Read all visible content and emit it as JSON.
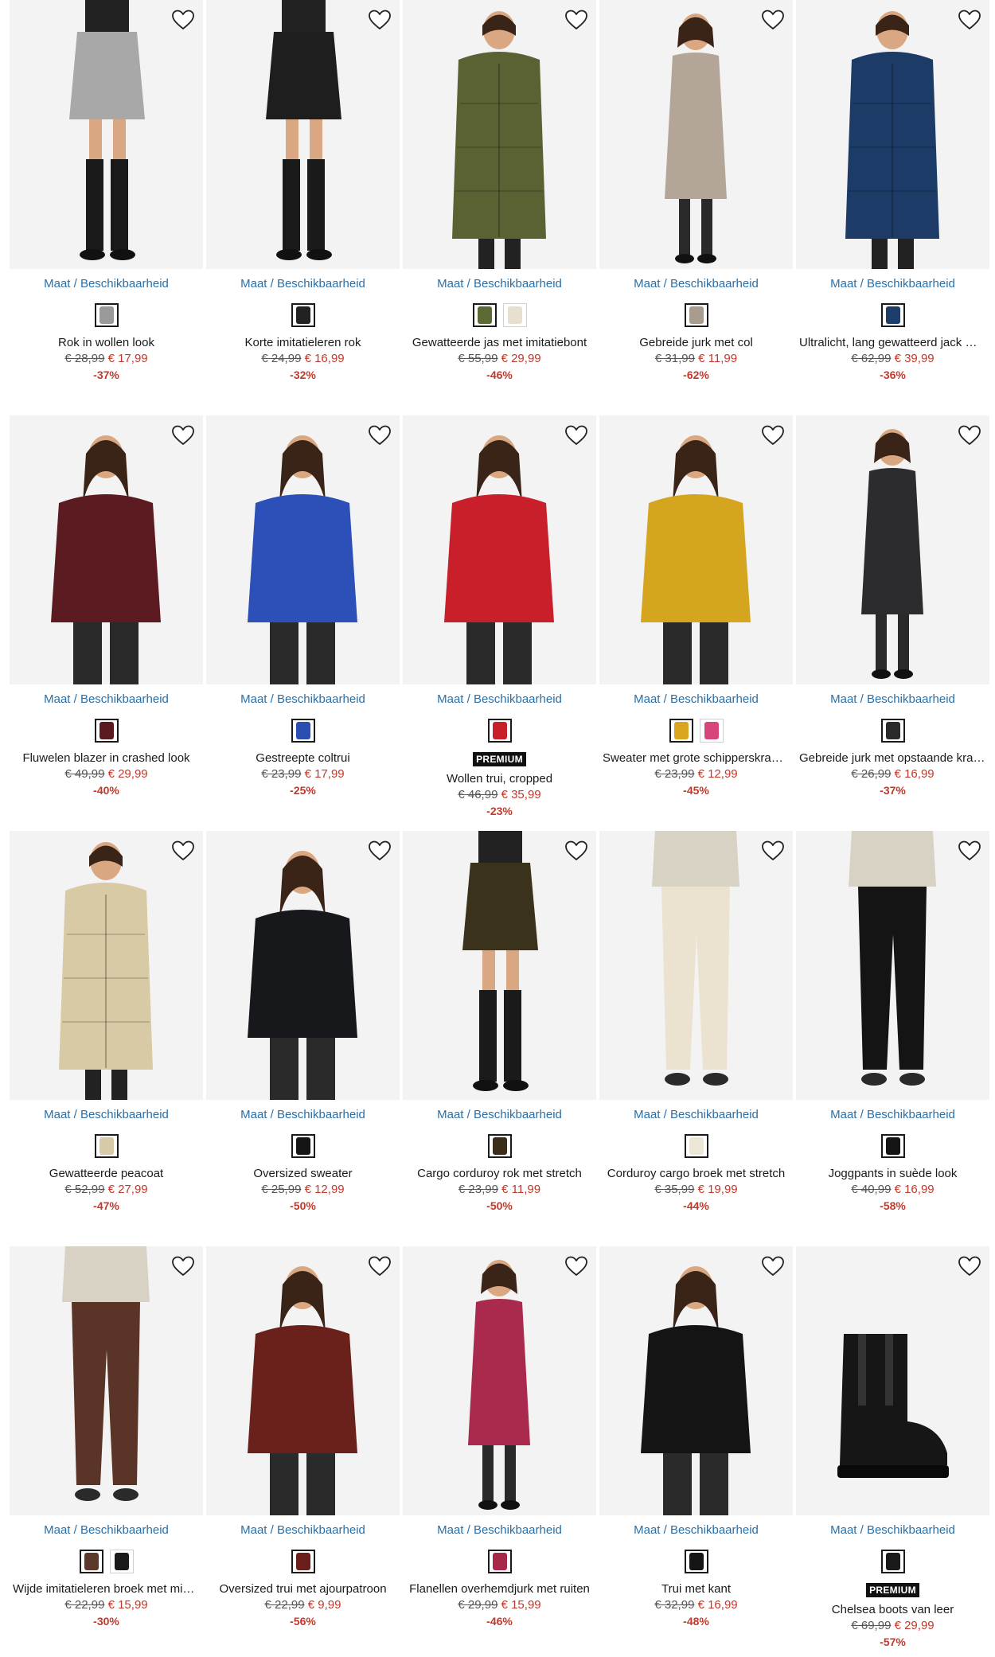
{
  "common": {
    "availability_label": "Maat / Beschikbaarheid",
    "premium_label": "PREMIUM",
    "heart_icon": "heart-icon"
  },
  "products": [
    {
      "title": "Rok in wollen look",
      "old_price": "€ 28,99",
      "new_price": "€ 17,99",
      "discount": "-37%",
      "premium": false,
      "swatches": [
        "#9a9a9a"
      ],
      "garment": "#a8a8a8",
      "image": "skirt"
    },
    {
      "title": "Korte imitatieleren rok",
      "old_price": "€ 24,99",
      "new_price": "€ 16,99",
      "discount": "-32%",
      "premium": false,
      "swatches": [
        "#222222"
      ],
      "garment": "#1e1e1e",
      "image": "skirt"
    },
    {
      "title": "Gewatteerde jas met imitatiebont",
      "old_price": "€ 55,99",
      "new_price": "€ 29,99",
      "discount": "-46%",
      "premium": false,
      "swatches": [
        "#5c6b35",
        "#e8e0cf"
      ],
      "garment": "#5a6234",
      "image": "coat"
    },
    {
      "title": "Gebreide jurk met col",
      "old_price": "€ 31,99",
      "new_price": "€ 11,99",
      "discount": "-62%",
      "premium": false,
      "swatches": [
        "#a89c8e"
      ],
      "garment": "#b3a597",
      "image": "dress"
    },
    {
      "title": "Ultralicht, lang gewatteerd jack met capuchon",
      "old_price": "€ 62,99",
      "new_price": "€ 39,99",
      "discount": "-36%",
      "premium": false,
      "swatches": [
        "#1d3d6b"
      ],
      "garment": "#1c3b66",
      "image": "coat"
    },
    {
      "title": "Fluwelen blazer in crashed look",
      "old_price": "€ 49,99",
      "new_price": "€ 29,99",
      "discount": "-40%",
      "premium": false,
      "swatches": [
        "#5a1a1f"
      ],
      "garment": "#5c1a21",
      "image": "top"
    },
    {
      "title": "Gestreepte coltrui",
      "old_price": "€ 23,99",
      "new_price": "€ 17,99",
      "discount": "-25%",
      "premium": false,
      "swatches": [
        "#2a4fb0"
      ],
      "garment": "#2d4fb8",
      "image": "top"
    },
    {
      "title": "Wollen trui, cropped",
      "old_price": "€ 46,99",
      "new_price": "€ 35,99",
      "discount": "-23%",
      "premium": true,
      "swatches": [
        "#c8202a"
      ],
      "garment": "#c81f2b",
      "image": "top"
    },
    {
      "title": "Sweater met grote schipperskraag, oversized",
      "old_price": "€ 23,99",
      "new_price": "€ 12,99",
      "discount": "-45%",
      "premium": false,
      "swatches": [
        "#d9a521",
        "#d8457a"
      ],
      "garment": "#d6a51f",
      "image": "top"
    },
    {
      "title": "Gebreide jurk met opstaande kraag",
      "old_price": "€ 26,99",
      "new_price": "€ 16,99",
      "discount": "-37%",
      "premium": false,
      "swatches": [
        "#2a2a2a"
      ],
      "garment": "#2c2c2e",
      "image": "dress"
    },
    {
      "title": "Gewatteerde peacoat",
      "old_price": "€ 52,99",
      "new_price": "€ 27,99",
      "discount": "-47%",
      "premium": false,
      "swatches": [
        "#d8c9a8"
      ],
      "garment": "#d9caa6",
      "image": "coat"
    },
    {
      "title": "Oversized sweater",
      "old_price": "€ 25,99",
      "new_price": "€ 12,99",
      "discount": "-50%",
      "premium": false,
      "swatches": [
        "#151515"
      ],
      "garment": "#17181c",
      "image": "top"
    },
    {
      "title": "Cargo corduroy rok met stretch",
      "old_price": "€ 23,99",
      "new_price": "€ 11,99",
      "discount": "-50%",
      "premium": false,
      "swatches": [
        "#3a2e1a"
      ],
      "garment": "#3b321b",
      "image": "skirt"
    },
    {
      "title": "Corduroy cargo broek met stretch",
      "old_price": "€ 35,99",
      "new_price": "€ 19,99",
      "discount": "-44%",
      "premium": false,
      "swatches": [
        "#ece6d6"
      ],
      "garment": "#ebe3cf",
      "image": "pants"
    },
    {
      "title": "Joggpants in suède look",
      "old_price": "€ 40,99",
      "new_price": "€ 16,99",
      "discount": "-58%",
      "premium": false,
      "swatches": [
        "#151515"
      ],
      "garment": "#141414",
      "image": "pants"
    },
    {
      "title": "Wijde imitatieleren broek met middelhoge taille",
      "old_price": "€ 22,99",
      "new_price": "€ 15,99",
      "discount": "-30%",
      "premium": false,
      "swatches": [
        "#5b3a2b",
        "#1a1a1a"
      ],
      "garment": "#5a3426",
      "image": "pants"
    },
    {
      "title": "Oversized trui met ajourpatroon",
      "old_price": "€ 22,99",
      "new_price": "€ 9,99",
      "discount": "-56%",
      "premium": false,
      "swatches": [
        "#6b1f1c"
      ],
      "garment": "#6a211c",
      "image": "top"
    },
    {
      "title": "Flanellen overhemdjurk met ruiten",
      "old_price": "€ 29,99",
      "new_price": "€ 15,99",
      "discount": "-46%",
      "premium": false,
      "swatches": [
        "#a8284a"
      ],
      "garment": "#a92a4c",
      "image": "dress"
    },
    {
      "title": "Trui met kant",
      "old_price": "€ 32,99",
      "new_price": "€ 16,99",
      "discount": "-48%",
      "premium": false,
      "swatches": [
        "#151515"
      ],
      "garment": "#141414",
      "image": "top"
    },
    {
      "title": "Chelsea boots van leer",
      "old_price": "€ 69,99",
      "new_price": "€ 29,99",
      "discount": "-57%",
      "premium": true,
      "swatches": [
        "#1a1a1a"
      ],
      "garment": "#161616",
      "image": "boot"
    }
  ]
}
